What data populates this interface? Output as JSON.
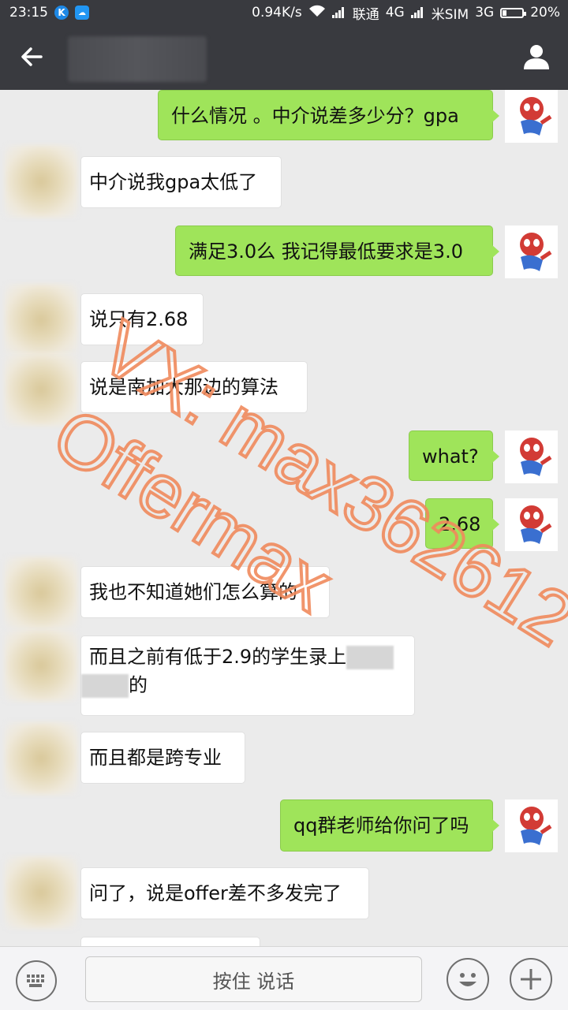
{
  "status_bar": {
    "time": "23:15",
    "speed": "0.94K/s",
    "carrier1": "联通",
    "network1": "4G",
    "carrier2": "米SIM",
    "network2": "3G",
    "battery": "20%",
    "battery_level": 0.2,
    "app_icon_letter": "K"
  },
  "nav": {
    "back_icon": "back-arrow-icon",
    "profile_icon": "person-icon"
  },
  "messages": [
    {
      "from": "self",
      "text": "什么情况 。中介说差多少分？gpa"
    },
    {
      "from": "other",
      "text": "中介说我gpa太低了"
    },
    {
      "from": "self",
      "text": "满足3.0么 我记得最低要求是3.0"
    },
    {
      "from": "other",
      "text": "说只有2.68"
    },
    {
      "from": "other",
      "text": "说是南加大那边的算法"
    },
    {
      "from": "self",
      "text": "what?"
    },
    {
      "from": "self",
      "text": "2.68"
    },
    {
      "from": "other",
      "text": "我也不知道她们怎么算的"
    },
    {
      "from": "other",
      "line1": "而且之前有低于2.9的学生录上",
      "line2": "的"
    },
    {
      "from": "other",
      "text": "而且都是跨专业"
    },
    {
      "from": "self",
      "text": "qq群老师给你问了吗"
    },
    {
      "from": "other",
      "text": "问了，说是offer差不多发完了"
    }
  ],
  "watermark": {
    "line1": "VX: max362612",
    "line2": "Offermax",
    "color": "#f08a5d"
  },
  "input_bar": {
    "hold_to_talk": "按住 说话",
    "keyboard_icon": "keyboard-icon",
    "emoji_icon": "smiley-icon",
    "plus_icon": "plus-icon"
  },
  "colors": {
    "self_bubble": "#9fe45a",
    "bar": "#393a3f"
  }
}
